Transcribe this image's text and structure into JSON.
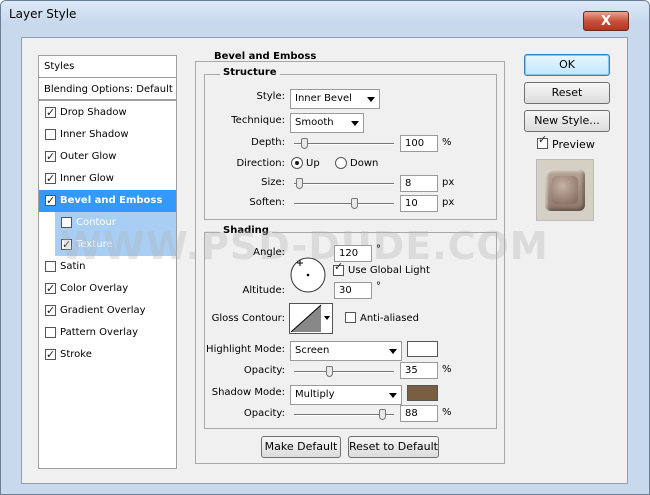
{
  "window": {
    "title": "Layer Style",
    "close_label": "X"
  },
  "sidebar": {
    "styles_header": "Styles",
    "blending_options": "Blending Options: Default",
    "items": [
      {
        "label": "Drop Shadow",
        "checked": true
      },
      {
        "label": "Inner Shadow",
        "checked": false
      },
      {
        "label": "Outer Glow",
        "checked": true
      },
      {
        "label": "Inner Glow",
        "checked": true
      },
      {
        "label": "Bevel and Emboss",
        "checked": true,
        "selected": true
      },
      {
        "label": "Contour",
        "checked": false,
        "sub": true
      },
      {
        "label": "Texture",
        "checked": true,
        "sub": true
      },
      {
        "label": "Satin",
        "checked": false
      },
      {
        "label": "Color Overlay",
        "checked": true
      },
      {
        "label": "Gradient Overlay",
        "checked": true
      },
      {
        "label": "Pattern Overlay",
        "checked": false
      },
      {
        "label": "Stroke",
        "checked": true
      }
    ]
  },
  "panel": {
    "title": "Bevel and Emboss",
    "structure": {
      "title": "Structure",
      "style_label": "Style:",
      "style_value": "Inner Bevel",
      "technique_label": "Technique:",
      "technique_value": "Smooth",
      "depth_label": "Depth:",
      "depth_value": "100",
      "depth_unit": "%",
      "depth_slider": 0.1,
      "direction_label": "Direction:",
      "direction_up": "Up",
      "direction_down": "Down",
      "direction_selected": "Up",
      "size_label": "Size:",
      "size_value": "8",
      "size_unit": "px",
      "size_slider": 0.05,
      "soften_label": "Soften:",
      "soften_value": "10",
      "soften_unit": "px",
      "soften_slider": 0.6
    },
    "shading": {
      "title": "Shading",
      "angle_label": "Angle:",
      "angle_value": "120",
      "angle_unit": "°",
      "use_global_light": "Use Global Light",
      "use_global_light_checked": true,
      "altitude_label": "Altitude:",
      "altitude_value": "30",
      "altitude_unit": "°",
      "gloss_contour_label": "Gloss Contour:",
      "anti_aliased": "Anti-aliased",
      "anti_aliased_checked": false,
      "highlight_mode_label": "Highlight Mode:",
      "highlight_mode_value": "Screen",
      "highlight_color": "#ffffff",
      "highlight_opacity_label": "Opacity:",
      "highlight_opacity_value": "35",
      "highlight_opacity_unit": "%",
      "highlight_opacity_slider": 0.35,
      "shadow_mode_label": "Shadow Mode:",
      "shadow_mode_value": "Multiply",
      "shadow_color": "#7a5e42",
      "shadow_opacity_label": "Opacity:",
      "shadow_opacity_value": "88",
      "shadow_opacity_unit": "%",
      "shadow_opacity_slider": 0.88
    },
    "make_default": "Make Default",
    "reset_to_default": "Reset to Default"
  },
  "buttons": {
    "ok": "OK",
    "reset": "Reset",
    "new_style": "New Style...",
    "preview": "Preview",
    "preview_checked": true
  },
  "watermark": "WWW.PSD-DUDE.COM",
  "icons": {
    "close": "close-icon",
    "dropdown": "chevron-down-icon",
    "checkbox": "checkbox-icon",
    "radio": "radio-icon",
    "angle_dial": "angle-dial-icon",
    "contour": "contour-curve-icon"
  }
}
